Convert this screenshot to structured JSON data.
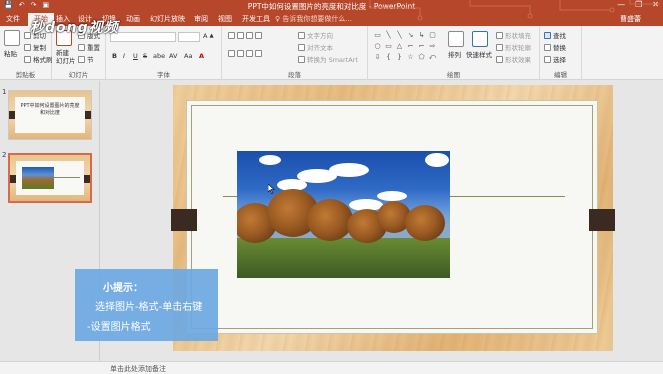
{
  "app": {
    "window_title": "PPT中如何设置图片的亮度和对比度 - PowerPoint",
    "user": "曹盛蕾",
    "accent_color": "#b7472a",
    "window_buttons": [
      "—",
      "❐",
      "✕"
    ]
  },
  "quick_access": [
    "💾",
    "↶",
    "↷",
    "▣"
  ],
  "tabs": [
    {
      "label": "文件",
      "active": false
    },
    {
      "label": "开始",
      "active": true
    },
    {
      "label": "插入",
      "active": false
    },
    {
      "label": "设计",
      "active": false
    },
    {
      "label": "切换",
      "active": false
    },
    {
      "label": "动画",
      "active": false
    },
    {
      "label": "幻灯片放映",
      "active": false
    },
    {
      "label": "审阅",
      "active": false
    },
    {
      "label": "视图",
      "active": false
    },
    {
      "label": "开发工具",
      "active": false
    }
  ],
  "tell_me": "♀ 告诉我你想要做什么...",
  "ribbon": {
    "clipboard": {
      "label": "剪贴板",
      "paste": "粘贴",
      "cut": "剪切",
      "copy": "复制",
      "format_painter": "格式刷"
    },
    "slides": {
      "label": "幻灯片",
      "new_slide": "新建\n幻灯片",
      "layout": "版式",
      "reset": "重置",
      "section": "节"
    },
    "font": {
      "label": "字体",
      "bold": "B",
      "italic": "I",
      "underline": "U",
      "strike": "S",
      "shadow": "abe",
      "spacing": "AV",
      "case": "Aa",
      "color": "A"
    },
    "paragraph": {
      "label": "段落",
      "text_direction": "文字方向",
      "align_text": "对齐文本",
      "smartart": "转换为 SmartArt"
    },
    "drawing": {
      "label": "绘图",
      "arrange": "排列",
      "quick_styles": "快速样式",
      "fill": "形状填充",
      "outline": "形状轮廓",
      "effects": "形状效果"
    },
    "editing": {
      "label": "编辑",
      "find": "查找",
      "replace": "替换",
      "select": "选择"
    }
  },
  "watermark": "秒dong视频",
  "slides_panel": {
    "slide1_number": "1",
    "slide1_text": "PPT中如何设置图片的亮度和对比度",
    "slide2_number": "2"
  },
  "shapes": [
    "▭",
    "╲",
    "╲",
    "↘",
    "↳",
    "▢",
    "○",
    "▭",
    "△",
    "⌐",
    "⌐",
    "⇨",
    "⇩",
    "{",
    "}",
    "☆",
    "⬠",
    "⤺"
  ],
  "tip": {
    "title": "小提示：",
    "line1": "选择图片-格式-单击右键",
    "line2": "-设置图片格式",
    "color": "#6da8e2"
  },
  "notes_placeholder": "单击此处添加备注"
}
